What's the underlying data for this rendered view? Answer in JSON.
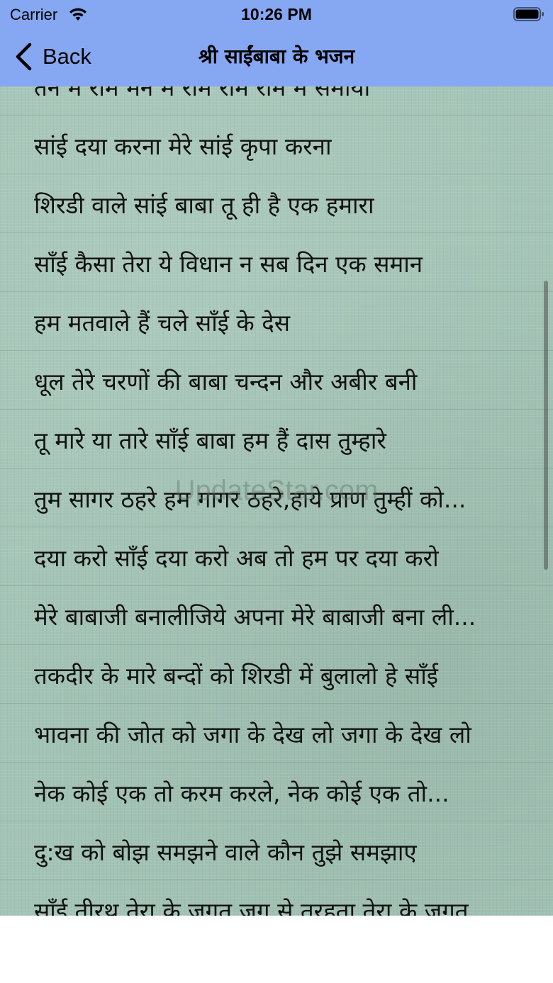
{
  "status_bar": {
    "carrier": "Carrier",
    "time": "10:26 PM",
    "icons": [
      "wifi-icon",
      "battery-icon"
    ]
  },
  "nav": {
    "back_label": "Back",
    "title": "श्री साईंबाबा के भजन"
  },
  "bhajans": [
    "तन में राम मन में राम रोम रोम में समाया",
    "सांई दया करना मेरे सांई कृपा करना",
    "शिरडी वाले सांई बाबा तू ही है एक हमारा",
    "साँई कैसा तेरा ये विधान न सब दिन एक समान",
    "हम मतवाले हैं चले साँई के देस",
    "धूल तेरे चरणों की बाबा चन्दन और अबीर बनी",
    "तू मारे या तारे  साँई बाबा हम हैं दास तुम्हारे",
    "तुम सागर ठहरे हम गागर ठहरे,हाये प्राण तुम्हीं को...",
    "दया करो साँई दया करो अब तो हम पर दया करो",
    "मेरे बाबाजी बनालीजिये अपना मेरे बाबाजी बना ली...",
    "तकदीर के मारे बन्दों को शिरडी में बुलालो हे साँई",
    "भावना की जोत को जगा के देख लो जगा के देख लो",
    "नेक कोई एक तो करम करले, नेक कोई एक तो...",
    "दु:ख को बोझ समझने वाले कौन तुझे समझाए",
    "साँई तीरथ तेरा के जगत जग से तरहता तेरा के जगत"
  ],
  "watermark": "UpdateStar.com",
  "colors": {
    "nav_bar": "#86a7f2",
    "content_bg": "#a3c4b6",
    "text": "#111111"
  }
}
